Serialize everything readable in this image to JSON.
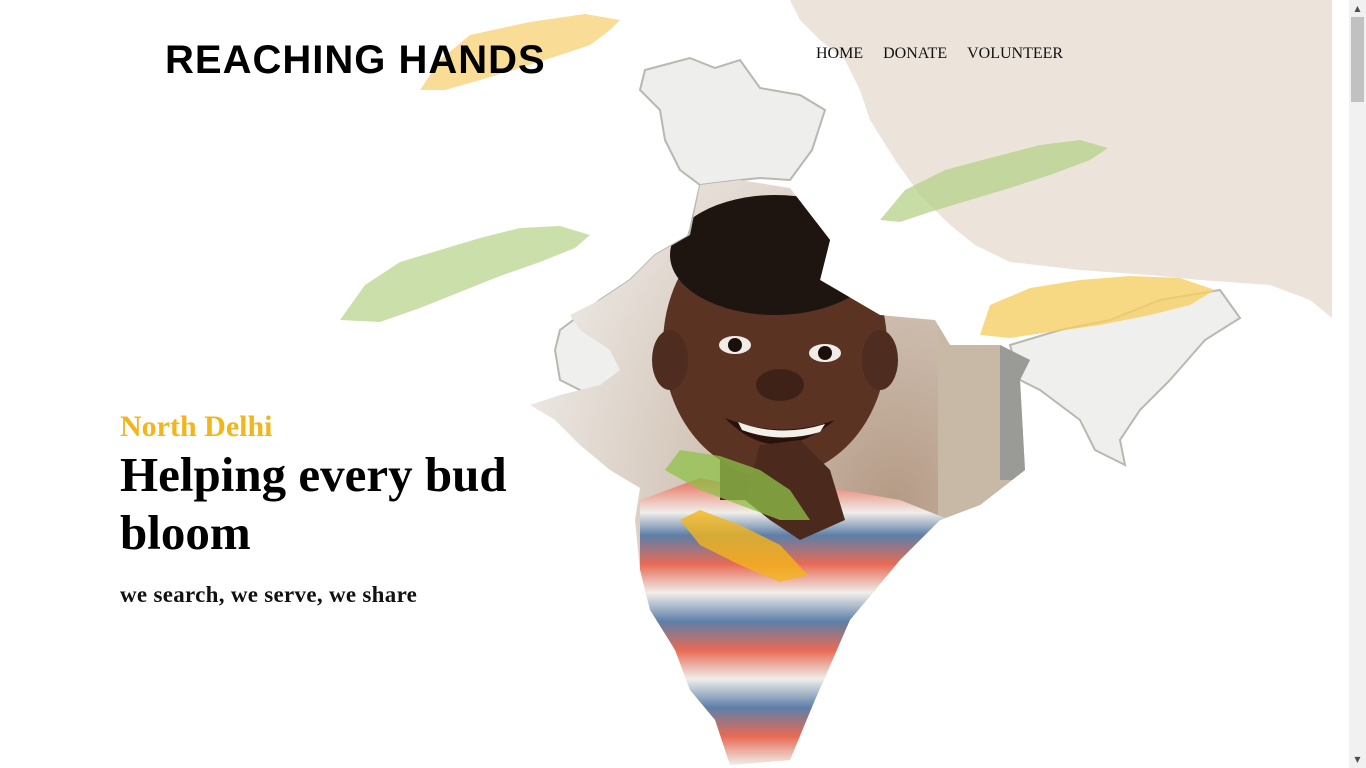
{
  "brand": {
    "logo": "REACHING HANDS"
  },
  "nav": {
    "items": [
      {
        "label": "HOME"
      },
      {
        "label": "DONATE"
      },
      {
        "label": "VOLUNTEER"
      }
    ]
  },
  "hero": {
    "location": "North Delhi",
    "headline": "Helping every bud bloom",
    "tagline": "we search, we serve, we share"
  },
  "colors": {
    "accent_yellow": "#f2b51c",
    "brush_green": "#b9d48e",
    "brush_yellow": "#f7d37a",
    "map_beige": "#eee4da"
  },
  "icons": {
    "scroll_up": "triangle-up",
    "scroll_down": "triangle-down"
  }
}
